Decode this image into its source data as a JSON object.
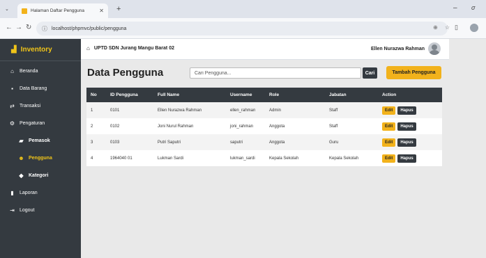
{
  "browser": {
    "tab_title": "Halaman Daftar Pengguna",
    "url": "localhost/phpmvc/public/pengguna"
  },
  "brand": {
    "label": "Inventory",
    "color": "#f0c419"
  },
  "sidebar": {
    "items": [
      {
        "label": "Beranda",
        "icon": "home-icon"
      },
      {
        "label": "Data Barang",
        "icon": "box-icon"
      },
      {
        "label": "Transaksi",
        "icon": "exchange-icon"
      },
      {
        "label": "Pengaturan",
        "icon": "gears-icon"
      },
      {
        "label": "Pemasok",
        "icon": "truck-icon"
      },
      {
        "label": "Pengguna",
        "icon": "users-icon"
      },
      {
        "label": "Kategori",
        "icon": "tag-icon"
      },
      {
        "label": "Laporan",
        "icon": "file-icon"
      },
      {
        "label": "Logout",
        "icon": "logout-icon"
      }
    ]
  },
  "header": {
    "school": "UPTD SDN Jurang Mangu Barat 02",
    "user_name": "Ellen Nurazwa Rahman"
  },
  "main": {
    "title": "Data Pengguna",
    "search_placeholder": "Cari Pengguna...",
    "search_button": "Cari",
    "add_button": "Tambah Pengguna",
    "columns": [
      "No",
      "ID Pengguna",
      "Full Name",
      "Username",
      "Role",
      "Jabatan",
      "Action"
    ],
    "rows": [
      [
        "1",
        "0101",
        "Ellen Nurazwa Rahman",
        "ellen_rahman",
        "Admin",
        "Staff"
      ],
      [
        "2",
        "0102",
        "Joni Nurul Rahman",
        "joni_rahman",
        "Anggota",
        "Staff"
      ],
      [
        "3",
        "0103",
        "Putri Saputri",
        "saputri",
        "Anggota",
        "Guru"
      ],
      [
        "4",
        "1964040 01",
        "Lukman Sardi",
        "lukman_sardi",
        "Kepala Sekolah",
        "Kepala Sekolah"
      ]
    ],
    "edit_label": "Edit",
    "delete_label": "Hapus"
  },
  "colors": {
    "accent": "#f2b21b",
    "sidebar_bg": "#343a40",
    "page_bg": "#e9e9e9"
  }
}
